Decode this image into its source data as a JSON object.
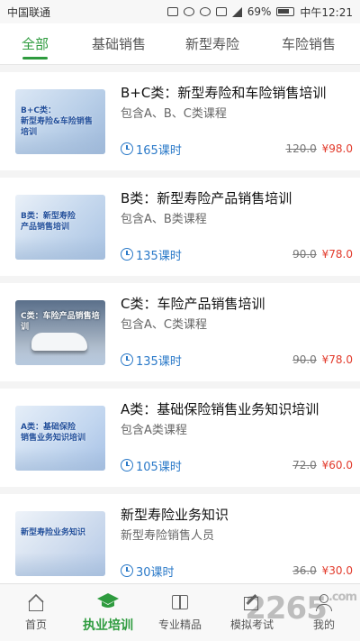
{
  "status_bar": {
    "carrier": "中国联通",
    "battery": "69%",
    "time": "中午12:21"
  },
  "tabs": [
    {
      "label": "全部",
      "active": true
    },
    {
      "label": "基础销售",
      "active": false
    },
    {
      "label": "新型寿险",
      "active": false
    },
    {
      "label": "车险销售",
      "active": false
    }
  ],
  "courses": [
    {
      "thumb_text": "B+C类：\n新型寿险&车险销售培训",
      "title": "B+C类：新型寿险和车险销售培训",
      "subtitle": "包含A、B、C类课程",
      "hours": "165课时",
      "old_price": "120.0",
      "price": "¥98.0"
    },
    {
      "thumb_text": "B类：新型寿险\n产品销售培训",
      "title": "B类：新型寿险产品销售培训",
      "subtitle": "包含A、B类课程",
      "hours": "135课时",
      "old_price": "90.0",
      "price": "¥78.0"
    },
    {
      "thumb_text": "C类：车险产品销售培训",
      "title": "C类：车险产品销售培训",
      "subtitle": "包含A、C类课程",
      "hours": "135课时",
      "old_price": "90.0",
      "price": "¥78.0"
    },
    {
      "thumb_text": "A类：基础保险\n销售业务知识培训",
      "title": "A类：基础保险销售业务知识培训",
      "subtitle": "包含A类课程",
      "hours": "105课时",
      "old_price": "72.0",
      "price": "¥60.0"
    },
    {
      "thumb_text": "新型寿险业务知识",
      "title": "新型寿险业务知识",
      "subtitle": "新型寿险销售人员",
      "hours": "30课时",
      "old_price": "36.0",
      "price": "¥30.0"
    }
  ],
  "bottom_nav": [
    {
      "label": "首页",
      "icon": "home-icon",
      "active": false
    },
    {
      "label": "执业培训",
      "icon": "graduation-cap-icon",
      "active": true
    },
    {
      "label": "专业精品",
      "icon": "book-icon",
      "active": false
    },
    {
      "label": "模拟考试",
      "icon": "edit-icon",
      "active": false
    },
    {
      "label": "我的",
      "icon": "user-icon",
      "active": false
    }
  ],
  "watermark": {
    "text": "2265",
    "suffix": ".com"
  },
  "colors": {
    "accent": "#2e9b3e",
    "link": "#2a79c8",
    "price": "#e23a2b"
  }
}
